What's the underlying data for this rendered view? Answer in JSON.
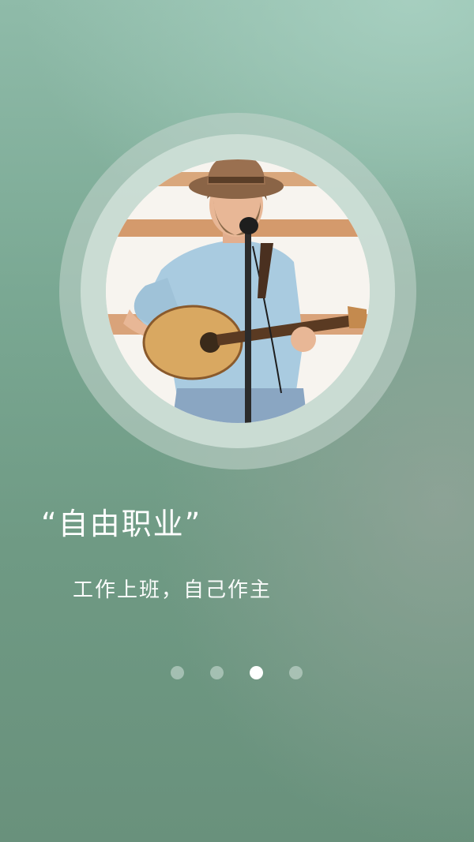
{
  "onboarding": {
    "headline": "“自由职业”",
    "subtitle": "工作上班，自己作主",
    "pager": {
      "total": 4,
      "active_index": 2
    },
    "image": {
      "subject": "musician-with-guitar"
    }
  },
  "colors": {
    "background_top": "#8fbba9",
    "background_bottom": "#69917c",
    "ring": "#c4d6ce",
    "text": "#ffffff",
    "dot_active": "#ffffff",
    "dot_inactive": "#d2e1da"
  }
}
